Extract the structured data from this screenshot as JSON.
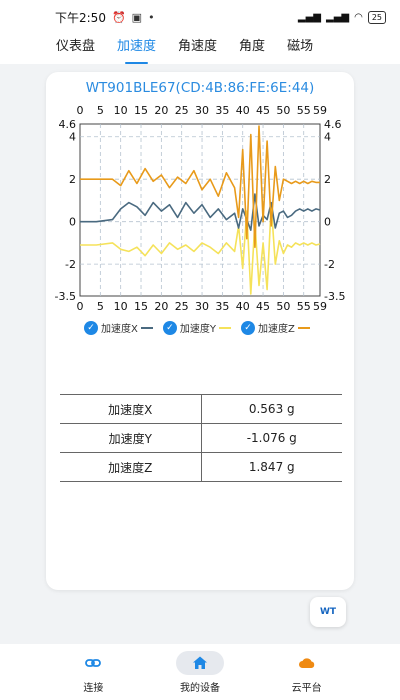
{
  "status": {
    "time": "下午2:50",
    "battery": "25"
  },
  "tabs": [
    {
      "label": "仪表盘"
    },
    {
      "label": "加速度"
    },
    {
      "label": "角速度"
    },
    {
      "label": "角度"
    },
    {
      "label": "磁场"
    }
  ],
  "active_tab": "加速度",
  "device_title": "WT901BLE67(CD:4B:86:FE:6E:44)",
  "chart_data": {
    "type": "line",
    "title": "WT901BLE67(CD:4B:86:FE:6E:44)",
    "x_ticks": [
      "0",
      "5",
      "10",
      "15",
      "20",
      "25",
      "30",
      "35",
      "40",
      "45",
      "50",
      "55",
      "59"
    ],
    "y_left_ticks": [
      "4.6",
      "4",
      "2",
      "0",
      "-2",
      "-3.5"
    ],
    "y_right_ticks": [
      "4.6",
      "4",
      "2",
      "0",
      "-2",
      "-3.5"
    ],
    "xlim": [
      0,
      59
    ],
    "ylim": [
      -3.5,
      4.6
    ],
    "grid": true,
    "legend_position": "bottom",
    "series": [
      {
        "name": "加速度X",
        "color": "#4a6a80",
        "x": [
          0,
          4,
          8,
          10,
          12,
          14,
          16,
          18,
          20,
          22,
          24,
          26,
          28,
          30,
          32,
          34,
          36,
          38,
          39,
          40,
          41,
          42,
          43,
          44,
          45,
          46,
          47,
          48,
          49,
          50,
          51,
          52,
          53,
          54,
          55,
          56,
          57,
          58,
          59
        ],
        "y": [
          0,
          0,
          0.1,
          0.6,
          0.9,
          0.7,
          0.3,
          0.9,
          0.5,
          0.8,
          0.2,
          0.9,
          0.4,
          0.8,
          0.2,
          0.6,
          0.1,
          0.4,
          -0.3,
          0.6,
          0.1,
          -0.4,
          1.3,
          -0.2,
          0.3,
          0.1,
          0.9,
          -0.3,
          0.4,
          0.5,
          0.2,
          0.3,
          0.5,
          0.6,
          0.5,
          0.6,
          0.5,
          0.6,
          0.55
        ]
      },
      {
        "name": "加速度Y",
        "color": "#f5e25a",
        "x": [
          0,
          4,
          8,
          10,
          12,
          14,
          16,
          18,
          20,
          22,
          24,
          26,
          28,
          30,
          32,
          34,
          36,
          38,
          39,
          40,
          41,
          42,
          43,
          44,
          45,
          46,
          47,
          48,
          49,
          50,
          51,
          52,
          53,
          54,
          55,
          56,
          57,
          58,
          59
        ],
        "y": [
          -1.1,
          -1.1,
          -1.0,
          -1.3,
          -1.4,
          -1.2,
          -1.6,
          -1.1,
          -1.5,
          -1.0,
          -1.3,
          -1.1,
          -1.4,
          -1.0,
          -1.2,
          -1.5,
          -1.0,
          -1.4,
          -0.2,
          -2.2,
          0.5,
          -3.4,
          0.0,
          -3.0,
          -1.0,
          -3.2,
          0.8,
          -2.0,
          -0.9,
          -1.5,
          -1.1,
          -1.2,
          -1.0,
          -1.1,
          -1.0,
          -1.1,
          -1.0,
          -1.1,
          -1.05
        ]
      },
      {
        "name": "加速度Z",
        "color": "#e89a1a",
        "x": [
          0,
          4,
          8,
          10,
          12,
          14,
          16,
          18,
          20,
          22,
          24,
          26,
          28,
          30,
          32,
          34,
          36,
          38,
          39,
          40,
          41,
          42,
          43,
          44,
          45,
          46,
          47,
          48,
          49,
          50,
          51,
          52,
          53,
          54,
          55,
          56,
          57,
          58,
          59
        ],
        "y": [
          2.0,
          2.0,
          2.0,
          1.7,
          2.4,
          1.8,
          2.5,
          1.9,
          2.2,
          1.6,
          2.1,
          1.8,
          2.4,
          1.5,
          2.0,
          1.2,
          2.3,
          1.6,
          0.2,
          3.4,
          -0.8,
          4.1,
          -1.2,
          4.5,
          0.0,
          3.8,
          -0.2,
          2.6,
          1.0,
          2.0,
          1.9,
          1.8,
          1.9,
          1.8,
          1.9,
          1.8,
          1.9,
          1.85,
          1.85
        ]
      }
    ]
  },
  "legend": [
    {
      "label": "加速度X",
      "color": "#4a6a80"
    },
    {
      "label": "加速度Y",
      "color": "#f5e25a"
    },
    {
      "label": "加速度Z",
      "color": "#e89a1a"
    }
  ],
  "table": [
    {
      "label": "加速度X",
      "value": "0.563 g"
    },
    {
      "label": "加速度Y",
      "value": "-1.076 g"
    },
    {
      "label": "加速度Z",
      "value": "1.847 g"
    }
  ],
  "fab_logo": "WT",
  "bottom_nav": [
    {
      "label": "连接",
      "icon": "link-icon"
    },
    {
      "label": "我的设备",
      "icon": "home-icon"
    },
    {
      "label": "云平台",
      "icon": "cloud-icon"
    }
  ],
  "colors": {
    "accent": "#1e88e5",
    "grid": "#b5c2cf"
  }
}
